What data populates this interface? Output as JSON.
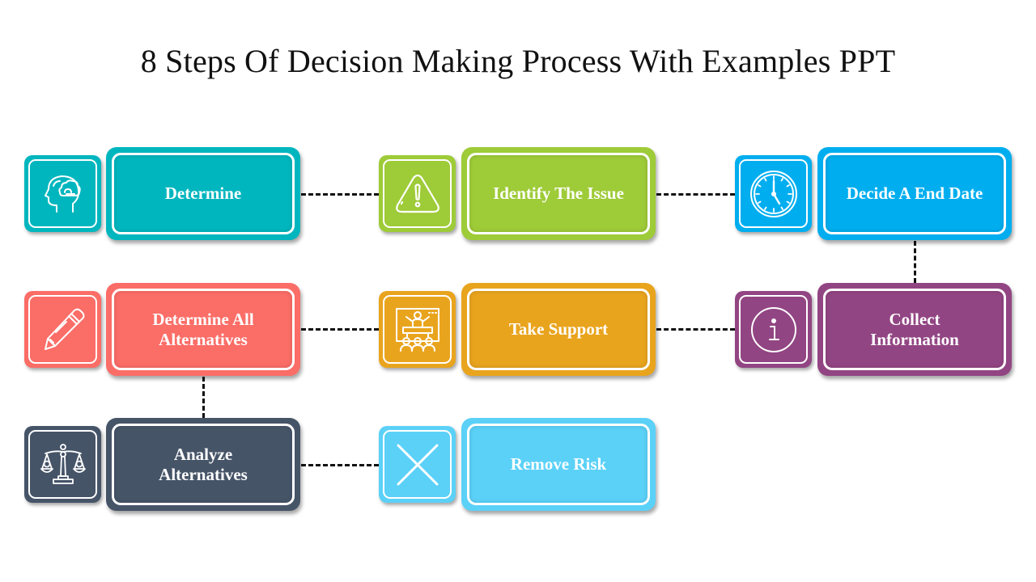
{
  "title": "8 Steps Of Decision Making Process With Examples PPT",
  "steps": [
    {
      "label": "Determine",
      "icon": "brain-head-icon",
      "color": "#00B6BE"
    },
    {
      "label": "Identify The Issue",
      "icon": "warning-triangle-icon",
      "color": "#9ECB38"
    },
    {
      "label": "Decide A End Date",
      "icon": "clock-icon",
      "color": "#00AEEF"
    },
    {
      "label": "Determine All Alternatives",
      "icon": "pencil-icon",
      "color": "#FB6D67"
    },
    {
      "label": "Take Support",
      "icon": "presentation-audience-icon",
      "color": "#E9A41E"
    },
    {
      "label": "Collect Information",
      "icon": "info-circle-icon",
      "color": "#924583"
    },
    {
      "label": "Analyze Alternatives",
      "icon": "balance-scale-icon",
      "color": "#465468"
    },
    {
      "label": "Remove Risk",
      "icon": "cross-icon",
      "color": "#5BD1F8"
    }
  ]
}
